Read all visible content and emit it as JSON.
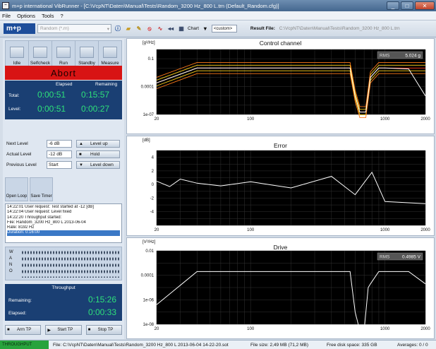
{
  "window": {
    "title": "m+p international VibRunner - [C:\\VcpNT\\Daten\\Manual\\Tests\\Random_3200 Hz_800 L.trn    (Default_Random.cfg)]",
    "minimize": "_",
    "maximize": "□",
    "close": "✕"
  },
  "menu": [
    "File",
    "Options",
    "Tools",
    "?"
  ],
  "toolbar": {
    "logo": "m+p",
    "profile": "Random (*.rn)",
    "chart_label": "Chart",
    "chart_mode": "<custom>",
    "result_label": "Result File:",
    "result_value": "C:\\VcpNT\\Daten\\Manual\\Tests\\Random_3200 Hz_800 L.trn"
  },
  "modes": [
    "Idle",
    "Selfcheck",
    "Run",
    "Standby",
    "Measure"
  ],
  "abort_label": "Abort",
  "times": {
    "elapsed_hdr": "Elapsed",
    "remaining_hdr": "Remaining",
    "total_label": "Total:",
    "level_label": "Level:",
    "total_elapsed": "0:00:51",
    "total_remaining": "0:15:57",
    "level_elapsed": "0:00:51",
    "level_remaining": "0:00:27"
  },
  "levels": {
    "next_label": "Next Level",
    "next_value": "-6 dB",
    "actual_label": "Actual Level",
    "actual_value": "-12 dB",
    "previous_label": "Previous Level",
    "previous_value": "Start",
    "up_label": "Level up",
    "hold_label": "Hold",
    "down_label": "Level down"
  },
  "loop": {
    "open_loop": "Open Loop",
    "save_timer": "Save Timer"
  },
  "log": [
    "14:22:01 User request: Test started at      -12 [dB]",
    "14:22:04 User request: Level fixed",
    "14:22:20 Throughput started:",
    "         File: Random_3200 Hz_800 L 2013-06-04",
    "         Rate: 8192 Hz",
    "         Duration: 0:16:00"
  ],
  "wano": [
    "W",
    "A",
    "N",
    "O"
  ],
  "throughput": {
    "title": "Throughput",
    "remaining_label": "Remaining:",
    "remaining_value": "0:15:26",
    "elapsed_label": "Elapsed:",
    "elapsed_value": "0:00:33"
  },
  "tp_buttons": [
    "Arm TP",
    "Start TP",
    "Stop TP"
  ],
  "charts": {
    "control": {
      "title": "Control channel",
      "unit": "[g²/Hz]",
      "rms_label": "RMS",
      "rms_value": "5.024 g"
    },
    "error": {
      "title": "Error",
      "unit": "[dB]"
    },
    "drive": {
      "title": "Drive",
      "unit": "[V²/Hz]",
      "rms_label": "RMS",
      "rms_value": "0.4985 V"
    }
  },
  "status": {
    "throughput": "THROUGHPUT",
    "file": "File: C:\\VcpNT\\Daten\\Manual\\Tests\\Random_3200 Hz_800 L 2013-06-04 14-22-20.sot",
    "size": "File size: 2,49 MB (71,2 MB)",
    "disk": "Free disk space: 335 GB",
    "averages": "Averages: 0 / 0"
  },
  "chart_data": [
    {
      "type": "line",
      "title": "Control channel",
      "ylabel": "[g²/Hz]",
      "xscale": "log",
      "yscale": "log",
      "xlim": [
        20,
        2000
      ],
      "ylim": [
        1e-07,
        1
      ],
      "xticks": [
        "20",
        "100",
        "1000",
        "2000"
      ],
      "yticks": [
        "0.1",
        "0.0001",
        "1e-07"
      ],
      "grid": true,
      "series": [
        {
          "x": [
            20,
            40,
            550,
            600,
            650,
            680,
            720,
            780,
            900,
            1000,
            2000
          ],
          "y": [
            0.00025,
            0.01,
            0.01,
            1e-05,
            1.8e-07,
            1.8e-07,
            1.8e-07,
            0.001,
            0.01,
            0.01,
            0.01
          ]
        },
        {
          "x": [
            20,
            40,
            550,
            600,
            650,
            720,
            780,
            900,
            1000,
            2000
          ],
          "y": [
            0.0005,
            0.02,
            0.02,
            2e-05,
            3.5e-07,
            3.5e-07,
            0.002,
            0.02,
            0.02,
            0.02
          ]
        },
        {
          "x": [
            20,
            40,
            550,
            600,
            650,
            720,
            780,
            900,
            1000,
            2000
          ],
          "y": [
            0.00012,
            0.005,
            0.005,
            5e-06,
            9e-08,
            9e-08,
            0.0005,
            0.005,
            0.005,
            0.005
          ]
        },
        {
          "x": [
            20,
            40,
            550,
            600,
            650,
            720,
            780,
            900,
            1000,
            2000
          ],
          "y": [
            0.001,
            0.04,
            0.04,
            4e-05,
            7e-07,
            7e-07,
            0.004,
            0.04,
            0.04,
            0.04
          ]
        },
        {
          "x": [
            20,
            40,
            550,
            600,
            650,
            720,
            780,
            900,
            1000,
            2000
          ],
          "y": [
            6e-05,
            0.0025,
            0.0025,
            2.5e-06,
            4.5e-08,
            4.5e-08,
            0.00025,
            0.0025,
            0.0025,
            0.0025
          ]
        },
        {
          "x": [
            20,
            40,
            550,
            600,
            650,
            720,
            780,
            900,
            1000,
            1500,
            2000
          ],
          "y": [
            0.00025,
            0.01,
            0.01,
            1e-05,
            1.8e-07,
            1.8e-07,
            0.001,
            0.01,
            0.01,
            0.008,
            1e-05
          ]
        }
      ]
    },
    {
      "type": "line",
      "title": "Error",
      "ylabel": "[dB]",
      "xscale": "log",
      "xlim": [
        20,
        2000
      ],
      "ylim": [
        -6,
        5
      ],
      "xticks": [
        "20",
        "100",
        "1000",
        "2000"
      ],
      "yticks": [
        "4",
        "2",
        "0",
        "-2",
        "-4"
      ],
      "grid": true,
      "series": [
        {
          "x": [
            20,
            25,
            30,
            40,
            60,
            100,
            200,
            400,
            600,
            800,
            1000,
            2000
          ],
          "y": [
            0.5,
            -0.3,
            0.8,
            0.2,
            -0.2,
            0.4,
            -0.5,
            1.2,
            -1.5,
            1.8,
            -2.5,
            -2.8
          ]
        }
      ]
    },
    {
      "type": "line",
      "title": "Drive",
      "ylabel": "[V²/Hz]",
      "xscale": "log",
      "yscale": "log",
      "xlim": [
        20,
        2000
      ],
      "ylim": [
        1e-08,
        0.01
      ],
      "xticks": [
        "20",
        "100",
        "1000",
        "2000"
      ],
      "yticks": [
        "0.01",
        "0.0001",
        "1e-06",
        "1e-08"
      ],
      "grid": true,
      "series": [
        {
          "x": [
            20,
            40,
            550,
            600,
            650,
            700,
            750,
            780,
            900,
            1000,
            1500,
            2000
          ],
          "y": [
            4e-07,
            0.0002,
            0.0002,
            1e-07,
            3e-09,
            3e-09,
            1e-05,
            2e-05,
            0.0002,
            0.0002,
            0.0002,
            2e-05
          ]
        }
      ]
    }
  ]
}
